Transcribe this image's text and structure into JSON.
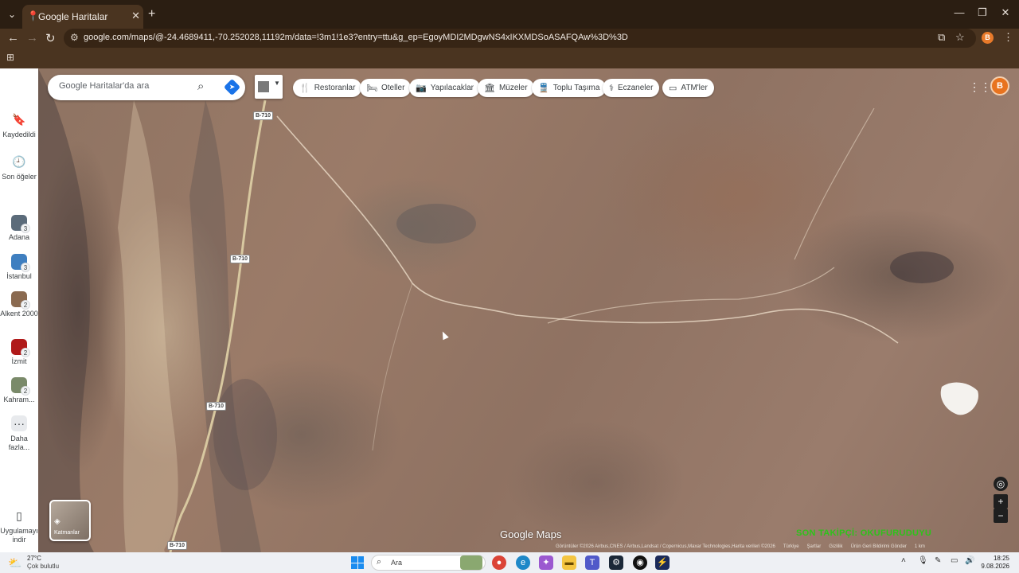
{
  "browser": {
    "tab_title": "Google Haritalar",
    "url": "google.com/maps/@-24.4689411,-70.252028,11192m/data=!3m1!1e3?entry=ttu&g_ep=EgoyMDI2MDgwNS4xIKXMDSoASAFQAw%3D%3D",
    "profile_initial": "B"
  },
  "rail": {
    "saved": "Kaydedildi",
    "recent": "Son öğeler",
    "recents": [
      {
        "label": "Adana",
        "badge": "3",
        "color": "#5b6b7a"
      },
      {
        "label": "İstanbul",
        "badge": "3",
        "color": "#3f7fc0"
      },
      {
        "label": "Alkent 2000",
        "badge": "2",
        "color": "#8a6a50"
      },
      {
        "label": "İzmit",
        "badge": "2",
        "color": "#b01a1a"
      },
      {
        "label": "Kahram...",
        "badge": "2",
        "color": "#7a8a6a"
      }
    ],
    "more": "Daha fazla...",
    "download": "Uygulamayı indir"
  },
  "search": {
    "placeholder": "Google Haritalar'da ara"
  },
  "chips": [
    {
      "icon": "restaurant-icon",
      "label": "Restoranlar"
    },
    {
      "icon": "hotel-icon",
      "label": "Oteller"
    },
    {
      "icon": "camera-icon",
      "label": "Yapılacaklar"
    },
    {
      "icon": "museum-icon",
      "label": "Müzeler"
    },
    {
      "icon": "transit-icon",
      "label": "Toplu Taşıma"
    },
    {
      "icon": "pharmacy-icon",
      "label": "Eczaneler"
    },
    {
      "icon": "atm-icon",
      "label": "ATM'ler"
    }
  ],
  "map": {
    "road_labels": [
      "B-710",
      "B-710",
      "B-710",
      "B-710"
    ],
    "layers_label": "Katmanlar",
    "logo": "Google Maps",
    "attribution": "Görüntüler ©2026 Airbus,CNES / Airbus,Landsat / Copernicus,Maxar Technologies,Harita verileri ©2026",
    "attribution_links": [
      "Türkiye",
      "Şartlar",
      "Gizlilik",
      "Ürün Geri Bildirimi Gönder"
    ],
    "scale": "1 km",
    "overlay_text": "SON TAKİPÇİ: OKUFURUDUYU"
  },
  "taskbar": {
    "temp": "27°C",
    "weather": "Çok bulutlu",
    "search_label": "Ara",
    "time": "18:25",
    "date": "9.08.2026"
  },
  "colors": {
    "accent": "#1a73e8",
    "chrome_bg": "#4a3420",
    "overlay_green": "#2ec21a"
  }
}
